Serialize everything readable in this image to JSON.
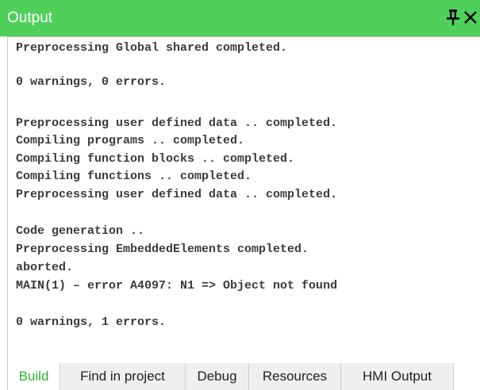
{
  "panel": {
    "title": "Output",
    "pin_icon": "pin-icon",
    "close_icon": "close-icon",
    "title_bar_color": "#4fd05b"
  },
  "log": {
    "lines": [
      "Preprocessing Global shared completed.",
      "",
      "0 warnings, 0 errors.",
      "",
      "Preprocessing user defined data .. completed.",
      "Compiling programs .. completed.",
      "Compiling function blocks .. completed.",
      "Compiling functions .. completed.",
      "Preprocessing user defined data .. completed.",
      "",
      "Code generation ..",
      "Preprocessing EmbeddedElements completed.",
      "aborted.",
      "MAIN(1) – error A4097: N1 => Object not found",
      "",
      "0 warnings, 1 errors."
    ]
  },
  "tabs": {
    "items": [
      {
        "label": "Build",
        "active": true
      },
      {
        "label": "Find in project",
        "active": false
      },
      {
        "label": "Debug",
        "active": false
      },
      {
        "label": "Resources",
        "active": false
      },
      {
        "label": "HMI Output",
        "active": false
      }
    ],
    "active_color": "#2bb52b"
  }
}
